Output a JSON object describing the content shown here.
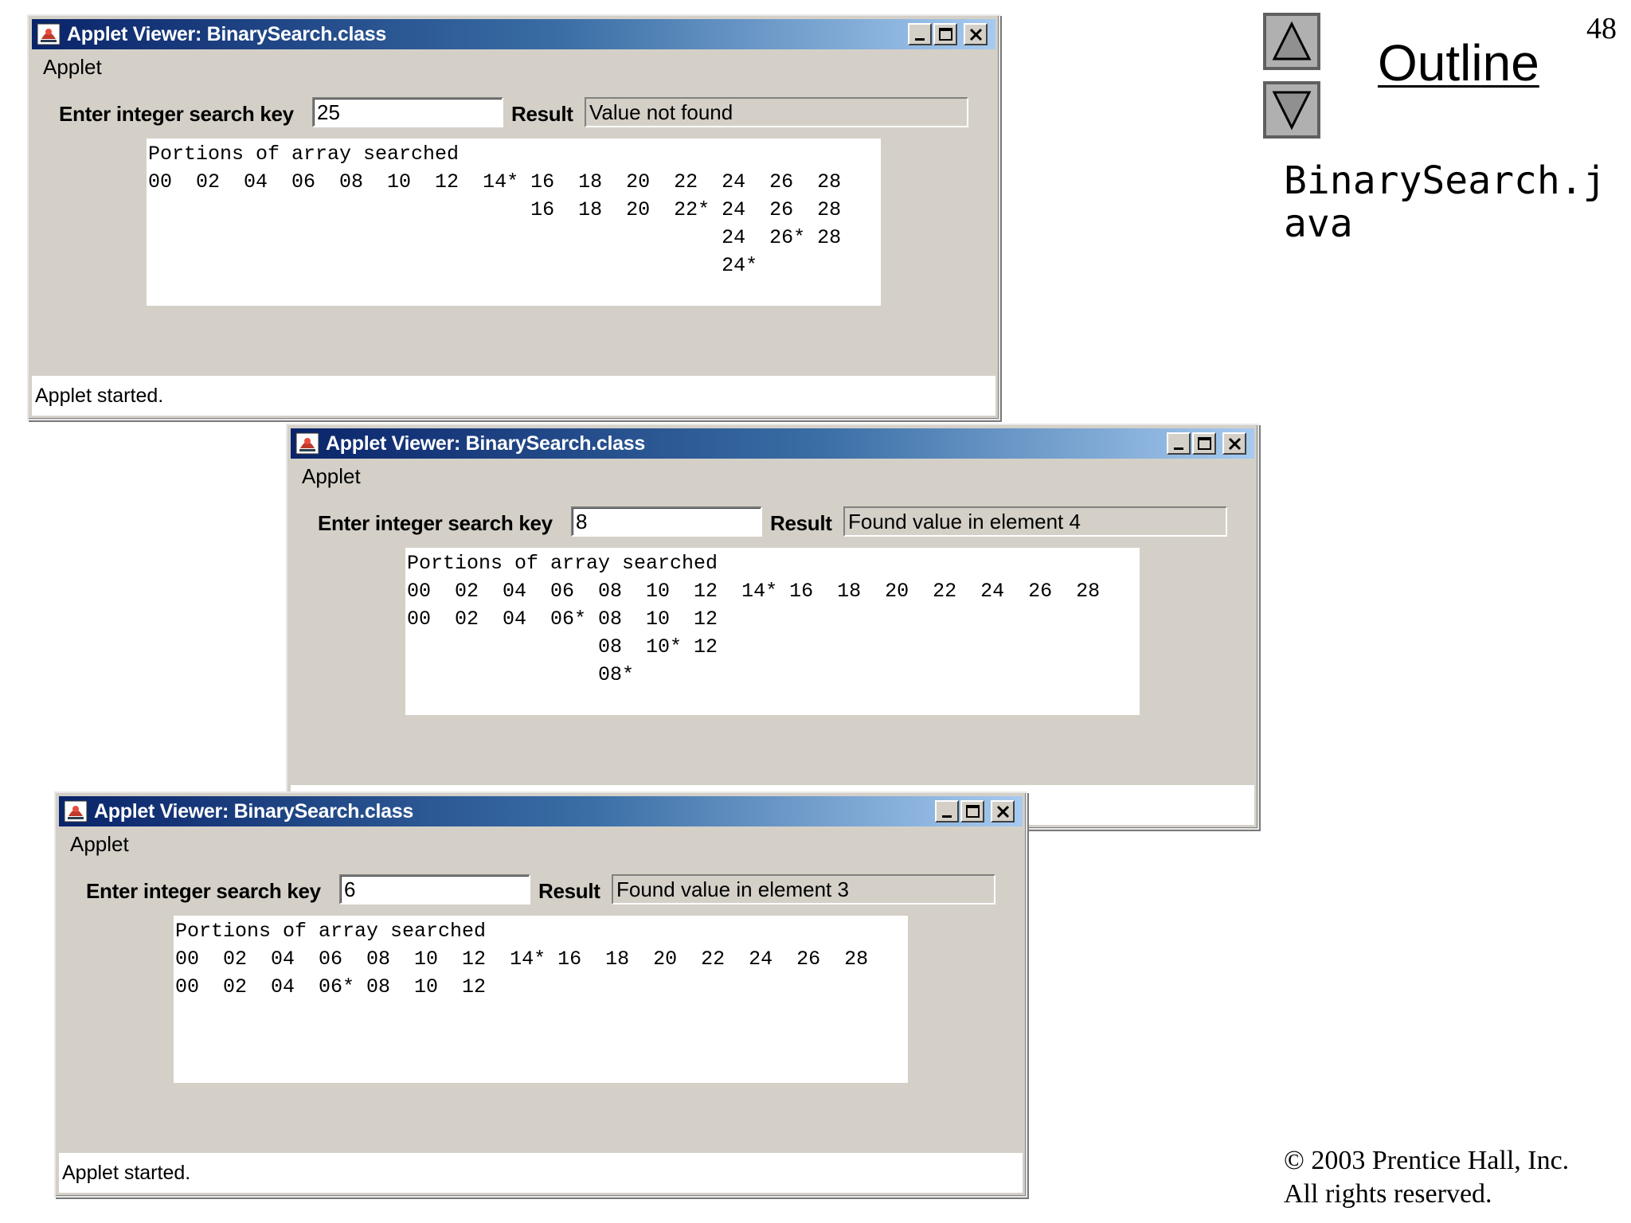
{
  "slide": {
    "page_number": "48",
    "outline_link": "Outline",
    "filename": "BinarySearch.java",
    "copyright_line1": "© 2003 Prentice Hall, Inc.",
    "copyright_line2": "All rights reserved.",
    "nav_up_icon": "triangle-up-icon",
    "nav_down_icon": "triangle-down-icon"
  },
  "windows": [
    {
      "title": "Applet Viewer: BinarySearch.class",
      "menu": "Applet",
      "search_label": "Enter integer search key",
      "search_value": "25",
      "result_label": "Result",
      "result_value": "Value not found",
      "output_lines": [
        "Portions of array searched",
        "00  02  04  06  08  10  12  14* 16  18  20  22  24  26  28",
        "                                16  18  20  22* 24  26  28",
        "                                                24  26* 28",
        "                                                24*"
      ],
      "status": "Applet started."
    },
    {
      "title": "Applet Viewer: BinarySearch.class",
      "menu": "Applet",
      "search_label": "Enter integer search key",
      "search_value": "8",
      "result_label": "Result",
      "result_value": "Found value in element 4",
      "output_lines": [
        "Portions of array searched",
        "00  02  04  06  08  10  12  14* 16  18  20  22  24  26  28",
        "00  02  04  06* 08  10  12",
        "                08  10* 12",
        "                08*"
      ],
      "status": ""
    },
    {
      "title": "Applet Viewer: BinarySearch.class",
      "menu": "Applet",
      "search_label": "Enter integer search key",
      "search_value": "6",
      "result_label": "Result",
      "result_value": "Found value in element 3",
      "output_lines": [
        "Portions of array searched",
        "00  02  04  06  08  10  12  14* 16  18  20  22  24  26  28",
        "00  02  04  06* 08  10  12"
      ],
      "status": "Applet started."
    }
  ]
}
